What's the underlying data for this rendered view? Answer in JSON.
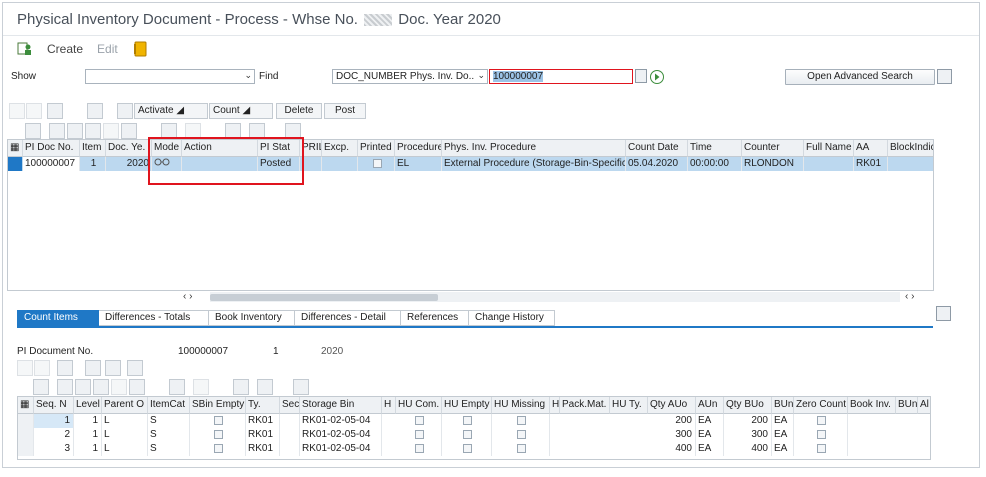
{
  "window": {
    "title_prefix": "Physical Inventory Document - Process - Whse No.",
    "title_suffix": "Doc. Year 2020"
  },
  "appbar": {
    "create_label": "Create",
    "edit_label": "Edit"
  },
  "search": {
    "show_label": "Show",
    "show_value": "",
    "find_label": "Find",
    "field_value": "DOC_NUMBER Phys. Inv. Do..",
    "query_value": "100000007",
    "advanced_label": "Open Advanced Search"
  },
  "toolbar_top": {
    "activate_label": "Activate",
    "count_label": "Count",
    "delete_label": "Delete",
    "post_label": "Post"
  },
  "upper_table": {
    "headers": [
      "PI Doc No.",
      "Item",
      "Doc. Ye.",
      "Mode",
      "Action",
      "PI Stat",
      "PRIL",
      "Excp.",
      "Printed",
      "Procedure",
      "Phys. Inv. Procedure",
      "Count Date",
      "Time",
      "Counter",
      "Full Name",
      "AA",
      "BlockIndic"
    ],
    "row": {
      "doc_no": "100000007",
      "item": "1",
      "year": "2020",
      "mode_icon": "glasses-icon",
      "action": "",
      "status": "Posted",
      "pril": "",
      "excp": "",
      "procedure": "EL",
      "procedure_desc": "External Procedure (Storage-Bin-Specific)",
      "count_date": "05.04.2020",
      "time": "00:00:00",
      "counter": "RLONDON",
      "full_name": "",
      "aa": "RK01",
      "block": ""
    }
  },
  "tabs": [
    "Count Items",
    "Differences - Totals",
    "Book Inventory",
    "Differences - Detail",
    "References",
    "Change History"
  ],
  "pi_info": {
    "label": "PI Document No.",
    "doc_no": "100000007",
    "item": "1",
    "year": "2020"
  },
  "lower_table": {
    "headers": [
      "Seq. N",
      "Level",
      "Parent O",
      "ItemCat",
      "SBin Empty",
      "Ty.",
      "Sec",
      "Storage Bin",
      "H",
      "HU Com.",
      "HU Empty",
      "HU Missing",
      "H",
      "Pack.Mat.",
      "HU Ty.",
      "Qty AUo",
      "AUn",
      "Qty BUo",
      "BUn",
      "Zero Count",
      "Book Inv.",
      "BUn",
      "Al"
    ],
    "rows": [
      {
        "seq": "1",
        "level": "1",
        "parent": "L",
        "itemcat": "S",
        "ty": "RK01",
        "bin": "RK01-02-05-04",
        "qty_auo": "200",
        "aun": "EA",
        "qty_buo": "200",
        "bun": "EA"
      },
      {
        "seq": "2",
        "level": "1",
        "parent": "L",
        "itemcat": "S",
        "ty": "RK01",
        "bin": "RK01-02-05-04",
        "qty_auo": "300",
        "aun": "EA",
        "qty_buo": "300",
        "bun": "EA"
      },
      {
        "seq": "3",
        "level": "1",
        "parent": "L",
        "itemcat": "S",
        "ty": "RK01",
        "bin": "RK01-02-05-04",
        "qty_auo": "400",
        "aun": "EA",
        "qty_buo": "400",
        "bun": "EA"
      }
    ]
  },
  "colors": {
    "accent": "#1f78c6",
    "highlight": "#e0141e",
    "selection": "#bcd8ef"
  }
}
